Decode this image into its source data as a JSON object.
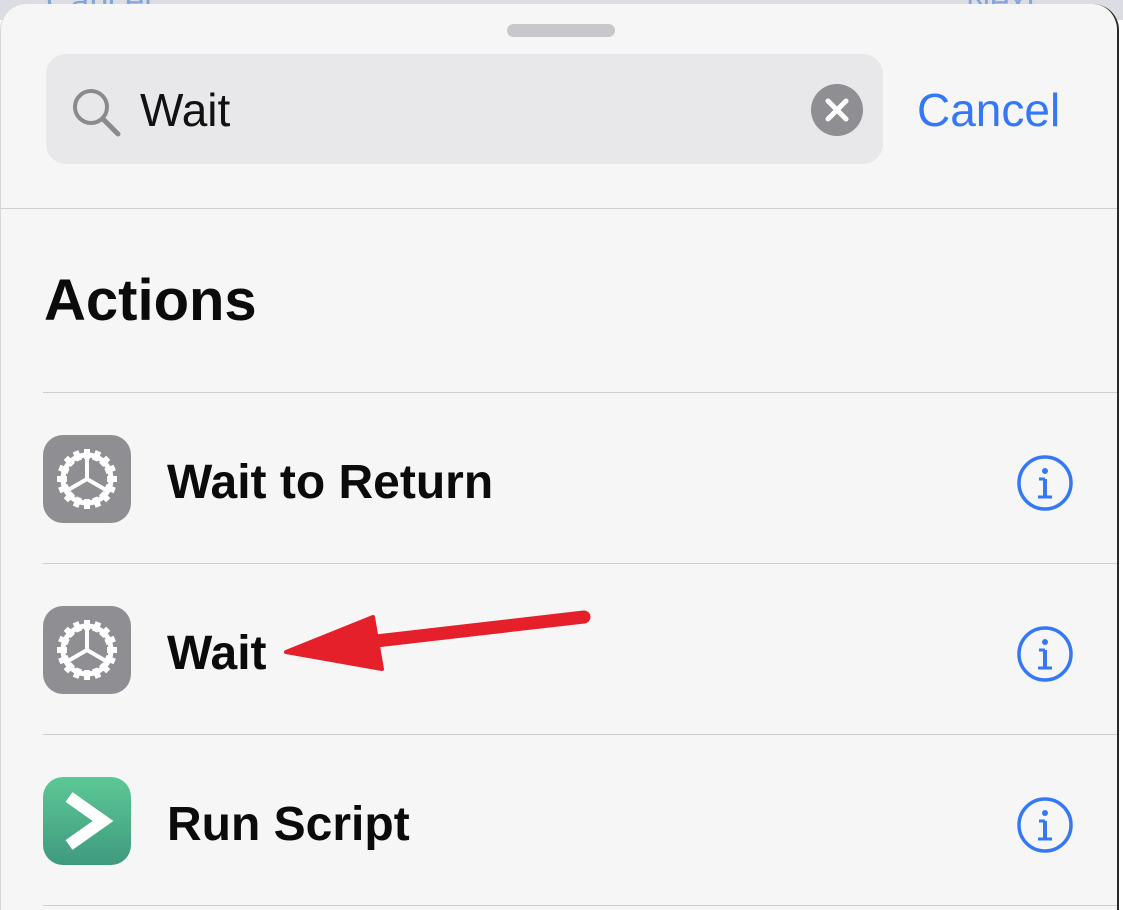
{
  "backdrop": {
    "left_text": "Cancel",
    "right_text": "Next"
  },
  "search": {
    "value": "Wait",
    "cancel_label": "Cancel"
  },
  "section": {
    "title": "Actions"
  },
  "actions": [
    {
      "label": "Wait to Return",
      "icon": "gear-icon"
    },
    {
      "label": "Wait",
      "icon": "gear-icon"
    },
    {
      "label": "Run Script",
      "icon": "run-script-icon"
    }
  ],
  "colors": {
    "accent": "#3478f6",
    "annotation_arrow": "#e5202a",
    "gear_tile": "#8e8e93",
    "script_tile": "#4bb48c"
  }
}
